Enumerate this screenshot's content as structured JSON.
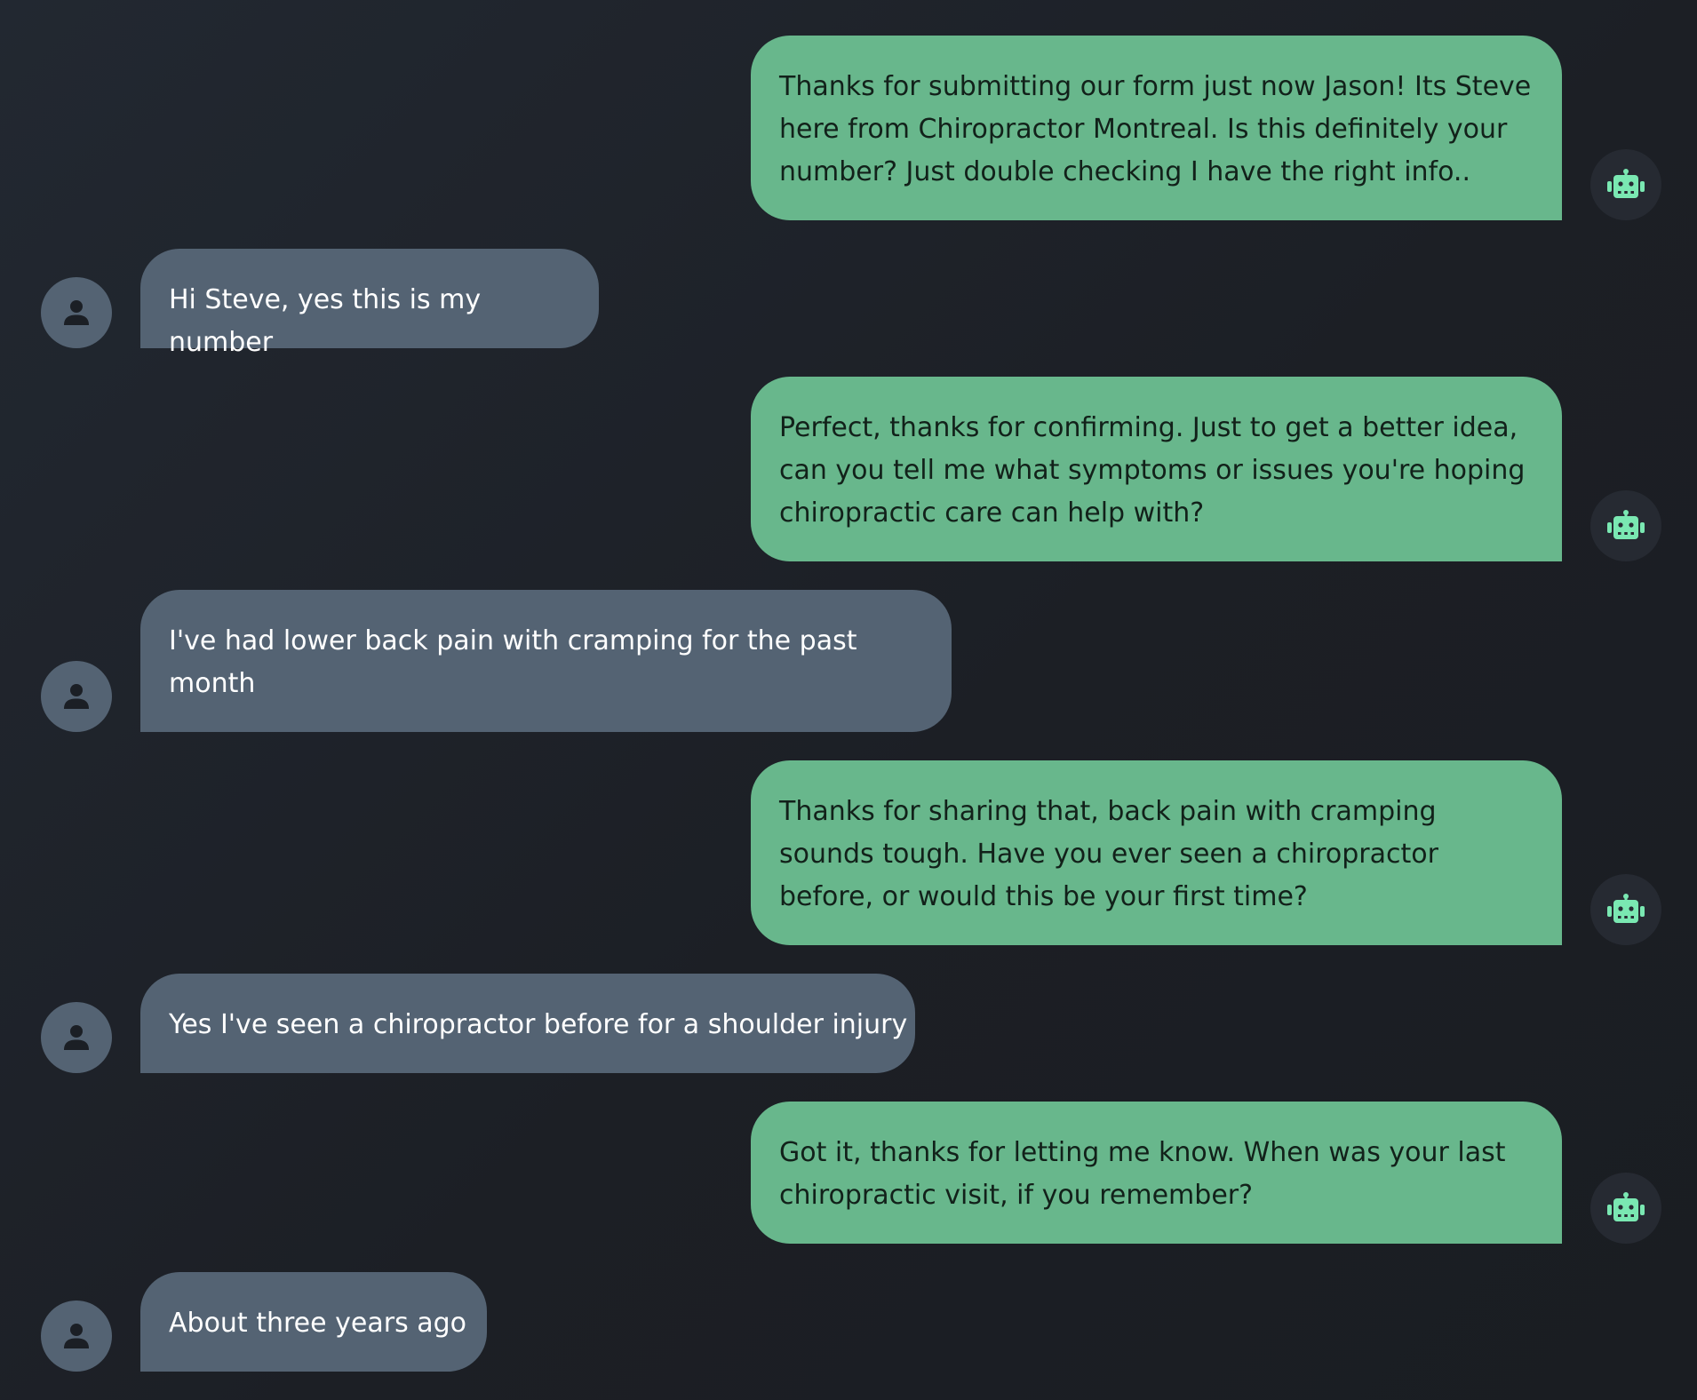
{
  "colors": {
    "background": "#1f232a",
    "bot_bubble": "#68b78c",
    "bot_text": "#12211a",
    "user_bubble": "#546373",
    "user_text": "#ffffff",
    "bot_icon": "#7ae8b2",
    "user_icon": "#1b1f25"
  },
  "icons": {
    "bot": "robot-icon",
    "user": "person-icon"
  },
  "messages": [
    {
      "sender": "bot",
      "text": "Thanks for submitting our form just now Jason! Its Steve here from Chiropractor Montreal. Is this definitely your number? Just double checking I have the right info.."
    },
    {
      "sender": "user",
      "text": "Hi Steve, yes this is my number"
    },
    {
      "sender": "bot",
      "text": "Perfect, thanks for confirming. Just to get a better idea, can you tell me what symptoms or issues you're hoping chiropractic care can help with?"
    },
    {
      "sender": "user",
      "text": "I've had lower back pain with cramping for the past month"
    },
    {
      "sender": "bot",
      "text": "Thanks for sharing that, back pain with cramping sounds tough. Have you ever seen a chiropractor before, or would this be your first time?"
    },
    {
      "sender": "user",
      "text": "Yes I've seen a chiropractor before for a shoulder injury"
    },
    {
      "sender": "bot",
      "text": "Got it, thanks for letting me know. When was your last chiropractic visit, if you remember?"
    },
    {
      "sender": "user",
      "text": "About three years ago"
    }
  ]
}
